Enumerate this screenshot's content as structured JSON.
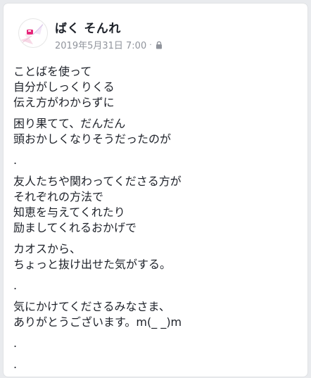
{
  "post": {
    "author": "ばく そんれ",
    "timestamp": "2019年5月31日 7:00",
    "separator": "·",
    "privacy_icon": "lock-icon",
    "colors": {
      "author": "#1d2129",
      "meta": "#90949c",
      "avatar_accent": "#e6267a"
    },
    "body": {
      "p1": [
        "ことばを使って",
        "自分がしっくりくる",
        "伝え方がわからずに"
      ],
      "p2": [
        "困り果てて、だんだん",
        "頭おかしくなりそうだったのが"
      ],
      "d1": ".",
      "p3": [
        "友人たちや関わってくださる方が",
        "それぞれの方法で",
        "知恵を与えてくれたり",
        "励ましてくれるおかげで"
      ],
      "p4": [
        "カオスから、",
        "ちょっと抜け出せた気がする。"
      ],
      "d2": ".",
      "p5": [
        "気にかけてくださるみなさま、",
        "ありがとうございます。m(_ _)m"
      ],
      "d3": ".",
      "d4": "."
    }
  }
}
